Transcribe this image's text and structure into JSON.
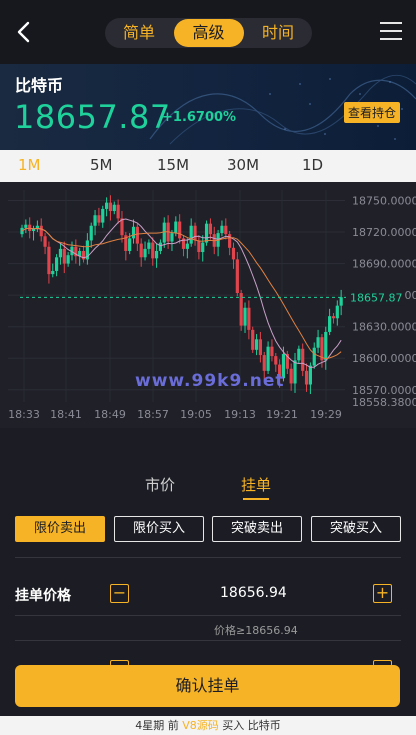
{
  "nav": {
    "tabs": [
      {
        "label": "简单",
        "active": false
      },
      {
        "label": "高级",
        "active": true
      },
      {
        "label": "时间",
        "active": false
      }
    ]
  },
  "header": {
    "coin": "比特币",
    "price": "18657.87",
    "change": "+1.6700%",
    "hold_button": "查看持仓"
  },
  "timeframes": [
    {
      "label": "1M",
      "active": true
    },
    {
      "label": "5M",
      "active": false
    },
    {
      "label": "15M",
      "active": false
    },
    {
      "label": "30M",
      "active": false
    },
    {
      "label": "1D",
      "active": false
    }
  ],
  "chart_data": {
    "type": "candlestick",
    "y_ticks": [
      "18750.0000",
      "18720.0000",
      "18690.0000",
      "18660.0000",
      "18630.0000",
      "18600.0000",
      "18570.0000",
      "18558.3800"
    ],
    "x_ticks": [
      "18:33",
      "18:41",
      "18:49",
      "18:57",
      "19:05",
      "19:13",
      "19:21",
      "19:29"
    ],
    "ylim": [
      18558.38,
      18760
    ],
    "current_price": "18657.87",
    "watermark": "www.99k9.net",
    "colors": {
      "up": "#1fd19b",
      "down": "#e0444c",
      "ma1": "#c9a0c8",
      "ma2": "#e08040",
      "current": "#1fd19b"
    }
  },
  "order_tabs": [
    {
      "label": "市价",
      "active": false
    },
    {
      "label": "挂单",
      "active": true
    }
  ],
  "order_types": [
    {
      "label": "限价卖出",
      "active": true
    },
    {
      "label": "限价买入",
      "active": false
    },
    {
      "label": "突破卖出",
      "active": false
    },
    {
      "label": "突破买入",
      "active": false
    }
  ],
  "price_row": {
    "label": "挂单价格",
    "minus": "−",
    "plus": "+",
    "value": "18656.94",
    "hint": "价格≥18656.94"
  },
  "confirm_button": "确认挂单",
  "footer": {
    "part1": "4星期 前",
    "highlight": "V8源码",
    "part2": "买入 比特币"
  },
  "colors": {
    "accent": "#f6b325",
    "up": "#1fd19b",
    "bg": "#1c1d24"
  }
}
